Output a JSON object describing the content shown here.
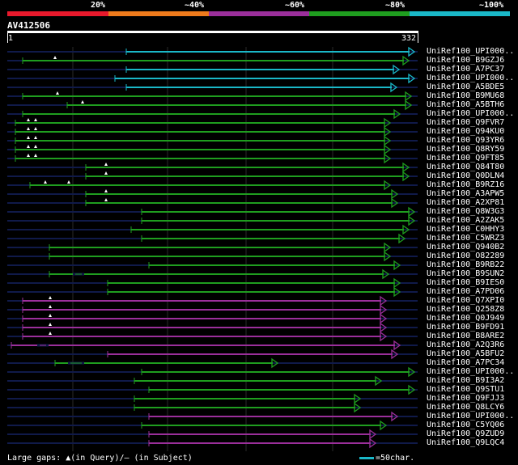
{
  "header": {
    "percent_labels": [
      "20%",
      "~40%",
      "~60%",
      "~80%",
      "~100%"
    ],
    "band_colors": [
      "#e8192c",
      "#ef7b1c",
      "#9b2f9b",
      "#1f9e1f",
      "#1ab8c8"
    ]
  },
  "query": {
    "name": "AV412506",
    "start": "1",
    "end": "332"
  },
  "hits": [
    {
      "label": "UniRef100_UPI000..",
      "color": "#1ab8c8"
    },
    {
      "label": "UniRef100_B9GZJ6",
      "color": "#1f9e1f"
    },
    {
      "label": "UniRef100_A7PC37",
      "color": "#1ab8c8"
    },
    {
      "label": "UniRef100_UPI000..",
      "color": "#1ab8c8"
    },
    {
      "label": "UniRef100_A5BDE5",
      "color": "#1ab8c8"
    },
    {
      "label": "UniRef100_B9MU68",
      "color": "#1f9e1f"
    },
    {
      "label": "UniRef100_A5BTH6",
      "color": "#1f9e1f"
    },
    {
      "label": "UniRef100_UPI000..",
      "color": "#1f9e1f"
    },
    {
      "label": "UniRef100_Q9FVR7",
      "color": "#1f9e1f"
    },
    {
      "label": "UniRef100_Q94KU0",
      "color": "#1f9e1f"
    },
    {
      "label": "UniRef100_Q93YR6",
      "color": "#1f9e1f"
    },
    {
      "label": "UniRef100_Q8RY59",
      "color": "#1f9e1f"
    },
    {
      "label": "UniRef100_Q9FT85",
      "color": "#1f9e1f"
    },
    {
      "label": "UniRef100_Q84T80",
      "color": "#1f9e1f"
    },
    {
      "label": "UniRef100_Q0DLN4",
      "color": "#1f9e1f"
    },
    {
      "label": "UniRef100_B9RZ16",
      "color": "#1f9e1f"
    },
    {
      "label": "UniRef100_A3APW5",
      "color": "#1f9e1f"
    },
    {
      "label": "UniRef100_A2XP81",
      "color": "#1f9e1f"
    },
    {
      "label": "UniRef100_Q8W3G3",
      "color": "#1f9e1f"
    },
    {
      "label": "UniRef100_A2ZAK5",
      "color": "#1f9e1f"
    },
    {
      "label": "UniRef100_C0HHY3",
      "color": "#1f9e1f"
    },
    {
      "label": "UniRef100_C5WRZ3",
      "color": "#1f9e1f"
    },
    {
      "label": "UniRef100_Q940B2",
      "color": "#1f9e1f"
    },
    {
      "label": "UniRef100_O82289",
      "color": "#1f9e1f"
    },
    {
      "label": "UniRef100_B9RB22",
      "color": "#1f9e1f"
    },
    {
      "label": "UniRef100_B9SUN2",
      "color": "#1f9e1f"
    },
    {
      "label": "UniRef100_B9IES0",
      "color": "#1f9e1f"
    },
    {
      "label": "UniRef100_A7PD06",
      "color": "#1f9e1f"
    },
    {
      "label": "UniRef100_Q7XPI0",
      "color": "#9b2f9b"
    },
    {
      "label": "UniRef100_Q258Z8",
      "color": "#9b2f9b"
    },
    {
      "label": "UniRef100_Q0J949",
      "color": "#9b2f9b"
    },
    {
      "label": "UniRef100_B9FD91",
      "color": "#9b2f9b"
    },
    {
      "label": "UniRef100_B8ARE2",
      "color": "#9b2f9b"
    },
    {
      "label": "UniRef100_A2Q3R6",
      "color": "#9b2f9b"
    },
    {
      "label": "UniRef100_A5BFU2",
      "color": "#9b2f9b"
    },
    {
      "label": "UniRef100_A7PC34",
      "color": "#1f9e1f"
    },
    {
      "label": "UniRef100_UPI000..",
      "color": "#1f9e1f"
    },
    {
      "label": "UniRef100_B9I3A2",
      "color": "#1f9e1f"
    },
    {
      "label": "UniRef100_Q9STU1",
      "color": "#1f9e1f"
    },
    {
      "label": "UniRef100_Q9FJJ3",
      "color": "#1f9e1f"
    },
    {
      "label": "UniRef100_Q8LCY6",
      "color": "#1f9e1f"
    },
    {
      "label": "UniRef100_UPI000..",
      "color": "#9b2f9b"
    },
    {
      "label": "UniRef100_C5YQ06",
      "color": "#1f9e1f"
    },
    {
      "label": "UniRef100_Q9ZUD9",
      "color": "#9b2f9b"
    },
    {
      "label": "UniRef100_Q9LQC4",
      "color": "#9b2f9b"
    }
  ],
  "legend": {
    "gaps_text": "Large gaps: ▲(in Query)/– (in Subject)",
    "scale_text": "=50char."
  }
}
